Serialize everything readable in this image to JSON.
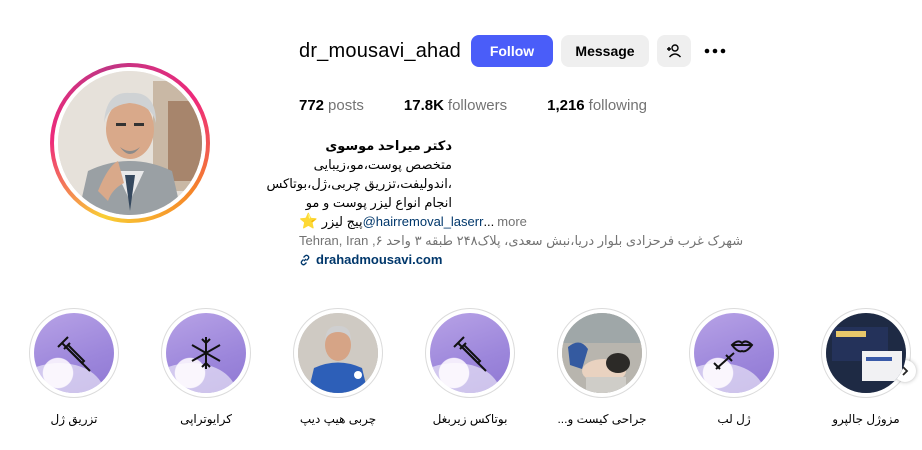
{
  "profile": {
    "username": "dr_mousavi_ahad",
    "follow_label": "Follow",
    "message_label": "Message",
    "add_user_icon": "person-add-icon",
    "more_icon": "ellipsis-icon"
  },
  "stats": {
    "posts_count": "772",
    "posts_label": "posts",
    "followers_count": "17.8K",
    "followers_label": "followers",
    "following_count": "1,216",
    "following_label": "following"
  },
  "bio": {
    "name": "دکتر میراحد موسوی",
    "line1": "متخصص پوست،مو،زیبایی",
    "line2": "،اندولیفت،تزریق چربی،ژل،بوتاکس",
    "line3": "انجام انواع لیزر پوست و مو",
    "star_icon": "⭐",
    "star_text": "پیج لیزر",
    "mention": "@hairremoval_laserr",
    "ellipsis": "...",
    "more_label": "more",
    "address": "Tehran, Iran ,۶ شهرک غرب فرحزادی بلوار دریا،نبش سعدی، پلاک۲۴۸ طبقه ۳ واحد",
    "link": "drahadmousavi.com"
  },
  "highlights": [
    {
      "label": "تزریق ژل",
      "icon": "syringe-icon"
    },
    {
      "label": "کرایوتراپی",
      "icon": "snowflake-icon"
    },
    {
      "label": "چربی هیپ دیپ",
      "icon": "photo"
    },
    {
      "label": "بوتاکس زیربغل",
      "icon": "syringe-icon"
    },
    {
      "label": "جراحی کیست و...",
      "icon": "photo"
    },
    {
      "label": "ژل لب",
      "icon": "lips-syringe-icon"
    },
    {
      "label": "مزوژل جالپرو",
      "icon": "photo"
    }
  ],
  "colors": {
    "follow_button": "#4a5df9",
    "link": "#00376b",
    "highlight_bg": "#9c86db"
  }
}
